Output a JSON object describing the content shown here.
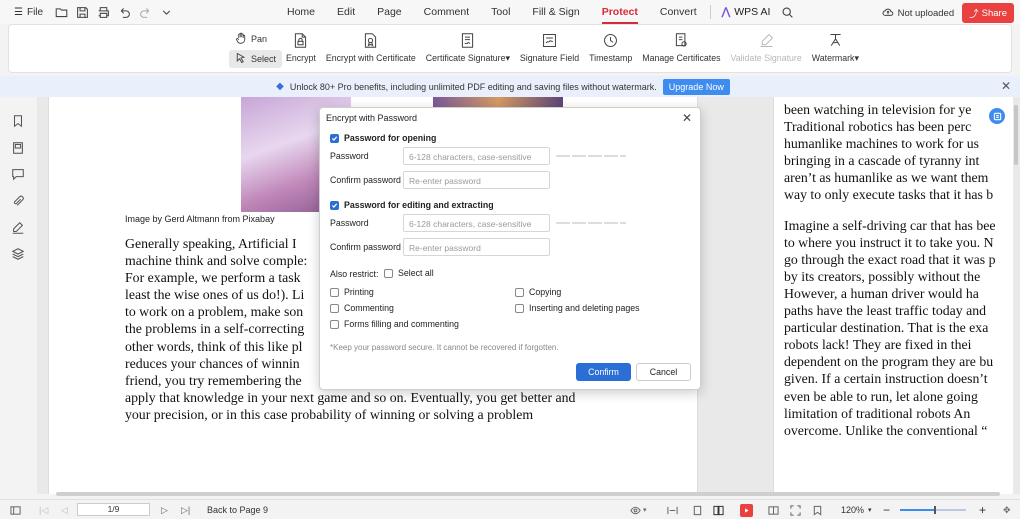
{
  "menubar": {
    "file_label": "File",
    "tabs": [
      {
        "label": "Home"
      },
      {
        "label": "Edit"
      },
      {
        "label": "Page"
      },
      {
        "label": "Comment"
      },
      {
        "label": "Tool"
      },
      {
        "label": "Fill & Sign"
      },
      {
        "label": "Protect"
      },
      {
        "label": "Convert"
      }
    ],
    "active_tab": "Protect",
    "wps_ai_label": "WPS AI",
    "upload_status": "Not uploaded",
    "share_label": "Share",
    "accent_color": "#d62b3a"
  },
  "ribbon": {
    "pan_label": "Pan",
    "select_label": "Select",
    "tools": [
      {
        "label": "Encrypt",
        "icon": "encrypt-icon"
      },
      {
        "label": "Encrypt with Certificate",
        "icon": "certificate-encrypt-icon"
      },
      {
        "label": "Certificate Signature",
        "icon": "certificate-signature-icon",
        "dropdown": "▾"
      },
      {
        "label": "Signature Field",
        "icon": "signature-field-icon"
      },
      {
        "label": "Timestamp",
        "icon": "timestamp-icon"
      },
      {
        "label": "Manage Certificates",
        "icon": "manage-certificates-icon"
      },
      {
        "label": "Validate Signature",
        "icon": "validate-signature-icon",
        "disabled": true
      },
      {
        "label": "Watermark",
        "icon": "watermark-icon",
        "dropdown": "▾"
      }
    ]
  },
  "promo": {
    "text": "Unlock 80+ Pro benefits, including unlimited PDF editing and saving files without watermark.",
    "upgrade_label": "Upgrade Now",
    "diamond": "◆",
    "close": "✕"
  },
  "document": {
    "caption": "Image by Gerd Altmann from Pixabay",
    "page1_lines": [
      "Generally speaking, Artificial I",
      "machine think and solve comple:",
      "For example, we perform a task",
      "least the wise ones of us do!). Li",
      "to work on a problem, make son",
      "the problems in a self-correcting",
      "other words, think of this like pl",
      "reduces your chances of winnin",
      "friend, you try remembering the",
      "apply that knowledge in your next game and so on. Eventually, you get better and",
      "your precision, or in this case probability of winning or solving a problem"
    ],
    "page2_para1": [
      "been watching in television for ye",
      "Traditional robotics has been perc",
      "humanlike machines to work for us",
      "bringing in a cascade of tyranny int",
      "aren’t as humanlike as we want them",
      "way to only execute tasks that it has b"
    ],
    "page2_para2": [
      "Imagine a self-driving car that has bee",
      "to where you instruct it to take you. N",
      "go through the exact road that it was p",
      "by its creators, possibly without the",
      "However, a human driver would ha",
      "paths have the least traffic today and",
      "particular destination. That is the exa",
      "robots lack! They are fixed in thei",
      "dependent on the program they are bu",
      "given. If a certain instruction doesn’t",
      "even be able to run, let alone going",
      "limitation of traditional robots An",
      "overcome. Unlike the conventional “"
    ]
  },
  "dialog": {
    "title": "Encrypt with Password",
    "close": "✕",
    "open_section": {
      "label": "Password for opening",
      "checked": true
    },
    "open_password_label": "Password",
    "open_password_placeholder": "6-128 characters, case-sensitive",
    "open_confirm_label": "Confirm password",
    "open_confirm_placeholder": "Re-enter password",
    "edit_section": {
      "label": "Password for editing and extracting",
      "checked": true
    },
    "edit_password_label": "Password",
    "edit_password_placeholder": "6-128 characters, case-sensitive",
    "edit_confirm_label": "Confirm password",
    "edit_confirm_placeholder": "Re-enter password",
    "also_restrict_label": "Also restrict:",
    "select_all_label": "Select all",
    "restrictions": [
      {
        "label": "Printing",
        "checked": false
      },
      {
        "label": "Copying",
        "checked": false
      },
      {
        "label": "Commenting",
        "checked": false
      },
      {
        "label": "Inserting and deleting pages",
        "checked": false
      },
      {
        "label": "Forms filling and commenting",
        "checked": false
      }
    ],
    "note": "*Keep your password secure. It cannot be recovered if forgotten.",
    "confirm_label": "Confirm",
    "cancel_label": "Cancel"
  },
  "statusbar": {
    "page_indicator": "1/9",
    "back_label": "Back to Page 9",
    "zoom": "120%",
    "zoom_level_fraction": 0.53
  }
}
